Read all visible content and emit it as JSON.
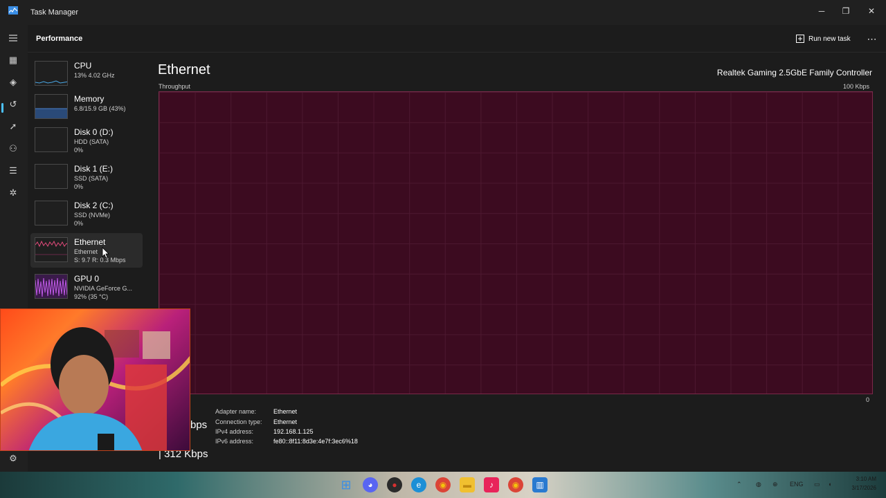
{
  "window": {
    "title": "Task Manager",
    "minimize_glyph": "─",
    "restore_glyph": "❐",
    "close_glyph": "✕"
  },
  "header": {
    "title": "Performance",
    "run_new_task_label": "Run new task",
    "more_glyph": "⋯"
  },
  "nav": {
    "menu_icon": "hamburger-icon",
    "items": [
      {
        "name": "processes",
        "icon": "grid-icon",
        "glyph": "▦"
      },
      {
        "name": "performance",
        "icon": "performance-icon",
        "glyph": "◈",
        "active": true
      },
      {
        "name": "app-history",
        "icon": "history-icon",
        "glyph": "↺"
      },
      {
        "name": "startup-apps",
        "icon": "startup-icon",
        "glyph": "➚"
      },
      {
        "name": "users",
        "icon": "users-icon",
        "glyph": "⚇"
      },
      {
        "name": "details",
        "icon": "details-icon",
        "glyph": "☰"
      },
      {
        "name": "services",
        "icon": "services-icon",
        "glyph": "✲"
      }
    ],
    "settings_glyph": "⚙"
  },
  "devices": [
    {
      "name": "CPU",
      "sub1": "13% 4.02 GHz",
      "sub2": "",
      "color": "#4aa9e8"
    },
    {
      "name": "Memory",
      "sub1": "6.8/15.9 GB (43%)",
      "sub2": "",
      "color": "#4a7fc8"
    },
    {
      "name": "Disk 0 (D:)",
      "sub1": "HDD (SATA)",
      "sub2": "0%",
      "color": "#6cbf3a"
    },
    {
      "name": "Disk 1 (E:)",
      "sub1": "SSD (SATA)",
      "sub2": "0%",
      "color": "#6cbf3a"
    },
    {
      "name": "Disk 2 (C:)",
      "sub1": "SSD (NVMe)",
      "sub2": "0%",
      "color": "#6cbf3a"
    },
    {
      "name": "Ethernet",
      "sub1": "Ethernet",
      "sub2": "S: 9.7 R: 0.3 Mbps",
      "color": "#e04a7a",
      "selected": true
    },
    {
      "name": "GPU 0",
      "sub1": "NVIDIA GeForce G...",
      "sub2": "92% (35 °C)",
      "color": "#b04ad8"
    }
  ],
  "main": {
    "title": "Ethernet",
    "adapter": "Realtek Gaming 2.5GbE Family Controller",
    "throughput_label": "Throughput",
    "max_label": "100 Kbps",
    "min_label": "0",
    "send_partial": "bps",
    "receive": "| 312 Kbps",
    "properties": [
      {
        "label": "Adapter name:",
        "value": "Ethernet"
      },
      {
        "label": "Connection type:",
        "value": "Ethernet"
      },
      {
        "label": "IPv4 address:",
        "value": "192.168.1.125"
      },
      {
        "label": "IPv6 address:",
        "value": "fe80::8f11:8d3e:4e7f:3ec6%18"
      }
    ]
  },
  "taskbar": {
    "apps": [
      {
        "name": "start",
        "icon": "windows-icon",
        "glyph": "⊞",
        "color": "#3a8ee6"
      },
      {
        "name": "discord",
        "icon": "discord-icon",
        "glyph": "◕",
        "color": "#5865f2"
      },
      {
        "name": "app-red",
        "icon": "app-icon",
        "glyph": "●",
        "color": "#d83030"
      },
      {
        "name": "edge",
        "icon": "edge-icon",
        "glyph": "e",
        "color": "#1c8fd6"
      },
      {
        "name": "chrome",
        "icon": "chrome-icon",
        "glyph": "◉",
        "color": "#e8a020"
      },
      {
        "name": "file-explorer",
        "icon": "folder-icon",
        "glyph": "▬",
        "color": "#f0c030"
      },
      {
        "name": "tiktok",
        "icon": "tiktok-icon",
        "glyph": "♪",
        "color": "#e8245a"
      },
      {
        "name": "chrome-2",
        "icon": "chrome-icon",
        "glyph": "◉",
        "color": "#e8a020"
      },
      {
        "name": "task-manager",
        "icon": "task-manager-icon",
        "glyph": "▥",
        "color": "#2a7ad0"
      }
    ],
    "tray_language": "ENG",
    "time": "3:10 AM",
    "date": "3/17/2026"
  }
}
